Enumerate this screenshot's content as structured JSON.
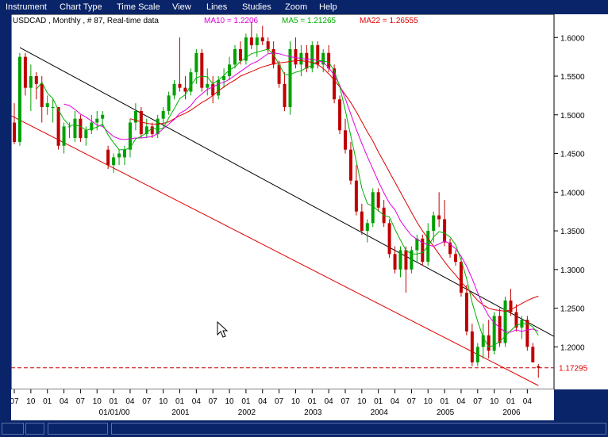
{
  "menu": {
    "items": [
      {
        "label": "Instrument"
      },
      {
        "label": "Chart Type"
      },
      {
        "label": "Time Scale"
      },
      {
        "label": "View"
      },
      {
        "label": "Lines"
      },
      {
        "label": "Studies"
      },
      {
        "label": "Zoom"
      },
      {
        "label": "Help"
      }
    ]
  },
  "legend": {
    "instrument": "USDCAD , Monthly , # 87, Real-time data",
    "ma10": "MA10 = 1.2206",
    "ma5": "MA5 = 1.21265",
    "ma22": "MA22 = 1.26555"
  },
  "colors": {
    "background": "#ffffff",
    "menubar": "#0a246a",
    "up_candle": "#00a000",
    "down_candle": "#c00000",
    "ma10": "#e000e0",
    "ma5": "#00b000",
    "ma22": "#e00000",
    "upper_channel": "#000000",
    "lower_channel": "#e00000"
  },
  "current_price_label": "1.17295",
  "chart_data": {
    "type": "candlestick",
    "instrument": "USDCAD",
    "timeframe": "Monthly",
    "ylim": [
      1.145,
      1.63
    ],
    "y_ticks": [
      "1.6000",
      "1.5500",
      "1.5000",
      "1.4500",
      "1.4000",
      "1.3500",
      "1.3000",
      "1.2500",
      "1.2000"
    ],
    "x_ticks": [
      "07",
      "10",
      "01",
      "04",
      "07",
      "10",
      "01",
      "04",
      "07",
      "10",
      "01",
      "04",
      "07",
      "10",
      "01",
      "04",
      "07",
      "10",
      "01",
      "04",
      "07",
      "10",
      "01",
      "04",
      "07",
      "10",
      "01",
      "04",
      "07",
      "10",
      "01",
      "04"
    ],
    "x_year_labels": [
      {
        "label": "01/01/00",
        "at": 6
      },
      {
        "label": "2001",
        "at": 10
      },
      {
        "label": "2002",
        "at": 14
      },
      {
        "label": "2003",
        "at": 18
      },
      {
        "label": "2004",
        "at": 22
      },
      {
        "label": "2005",
        "at": 26
      },
      {
        "label": "2006",
        "at": 30
      }
    ],
    "first_month": "1999-07",
    "candles": [
      [
        1.49,
        1.515,
        1.462,
        1.465
      ],
      [
        1.465,
        1.58,
        1.46,
        1.575
      ],
      [
        1.575,
        1.58,
        1.525,
        1.535
      ],
      [
        1.535,
        1.565,
        1.505,
        1.55
      ],
      [
        1.55,
        1.555,
        1.52,
        1.54
      ],
      [
        1.54,
        1.55,
        1.49,
        1.51
      ],
      [
        1.51,
        1.525,
        1.5,
        1.515
      ],
      [
        1.51,
        1.52,
        1.49,
        1.51
      ],
      [
        1.51,
        1.51,
        1.455,
        1.46
      ],
      [
        1.46,
        1.49,
        1.45,
        1.485
      ],
      [
        1.485,
        1.49,
        1.47,
        1.485
      ],
      [
        1.47,
        1.505,
        1.465,
        1.495
      ],
      [
        1.495,
        1.5,
        1.465,
        1.47
      ],
      [
        1.47,
        1.485,
        1.46,
        1.48
      ],
      [
        1.48,
        1.5,
        1.475,
        1.49
      ],
      [
        1.49,
        1.505,
        1.48,
        1.495
      ],
      [
        1.495,
        1.505,
        1.485,
        1.5
      ],
      [
        1.455,
        1.46,
        1.43,
        1.435
      ],
      [
        1.435,
        1.45,
        1.425,
        1.445
      ],
      [
        1.445,
        1.455,
        1.435,
        1.45
      ],
      [
        1.445,
        1.46,
        1.435,
        1.455
      ],
      [
        1.455,
        1.495,
        1.445,
        1.49
      ],
      [
        1.49,
        1.515,
        1.48,
        1.505
      ],
      [
        1.505,
        1.51,
        1.47,
        1.475
      ],
      [
        1.475,
        1.495,
        1.47,
        1.485
      ],
      [
        1.485,
        1.49,
        1.47,
        1.475
      ],
      [
        1.475,
        1.5,
        1.47,
        1.495
      ],
      [
        1.495,
        1.51,
        1.485,
        1.505
      ],
      [
        1.505,
        1.53,
        1.5,
        1.525
      ],
      [
        1.525,
        1.545,
        1.52,
        1.54
      ],
      [
        1.54,
        1.6,
        1.53,
        1.535
      ],
      [
        1.535,
        1.55,
        1.52,
        1.53
      ],
      [
        1.53,
        1.56,
        1.525,
        1.555
      ],
      [
        1.555,
        1.585,
        1.54,
        1.58
      ],
      [
        1.58,
        1.585,
        1.53,
        1.535
      ],
      [
        1.535,
        1.56,
        1.525,
        1.54
      ],
      [
        1.54,
        1.55,
        1.515,
        1.525
      ],
      [
        1.525,
        1.55,
        1.52,
        1.545
      ],
      [
        1.545,
        1.56,
        1.535,
        1.55
      ],
      [
        1.55,
        1.575,
        1.545,
        1.565
      ],
      [
        1.565,
        1.59,
        1.56,
        1.585
      ],
      [
        1.585,
        1.595,
        1.565,
        1.57
      ],
      [
        1.57,
        1.605,
        1.565,
        1.6
      ],
      [
        1.6,
        1.62,
        1.585,
        1.59
      ],
      [
        1.59,
        1.605,
        1.575,
        1.6
      ],
      [
        1.6,
        1.615,
        1.59,
        1.595
      ],
      [
        1.595,
        1.6,
        1.58,
        1.585
      ],
      [
        1.585,
        1.595,
        1.56,
        1.565
      ],
      [
        1.565,
        1.57,
        1.535,
        1.54
      ],
      [
        1.54,
        1.555,
        1.505,
        1.51
      ],
      [
        1.51,
        1.595,
        1.5,
        1.585
      ],
      [
        1.585,
        1.6,
        1.56,
        1.565
      ],
      [
        1.565,
        1.59,
        1.55,
        1.58
      ],
      [
        1.58,
        1.59,
        1.555,
        1.56
      ],
      [
        1.56,
        1.595,
        1.555,
        1.59
      ],
      [
        1.59,
        1.595,
        1.56,
        1.565
      ],
      [
        1.565,
        1.585,
        1.555,
        1.58
      ],
      [
        1.58,
        1.59,
        1.555,
        1.56
      ],
      [
        1.56,
        1.565,
        1.515,
        1.52
      ],
      [
        1.52,
        1.525,
        1.475,
        1.48
      ],
      [
        1.48,
        1.495,
        1.45,
        1.455
      ],
      [
        1.455,
        1.465,
        1.41,
        1.415
      ],
      [
        1.415,
        1.435,
        1.37,
        1.375
      ],
      [
        1.375,
        1.385,
        1.345,
        1.35
      ],
      [
        1.35,
        1.365,
        1.335,
        1.36
      ],
      [
        1.36,
        1.405,
        1.355,
        1.4
      ],
      [
        1.4,
        1.405,
        1.375,
        1.38
      ],
      [
        1.38,
        1.39,
        1.355,
        1.36
      ],
      [
        1.36,
        1.365,
        1.315,
        1.32
      ],
      [
        1.32,
        1.33,
        1.295,
        1.3
      ],
      [
        1.3,
        1.33,
        1.29,
        1.325
      ],
      [
        1.325,
        1.33,
        1.27,
        1.3
      ],
      [
        1.3,
        1.33,
        1.295,
        1.325
      ],
      [
        1.325,
        1.345,
        1.31,
        1.34
      ],
      [
        1.34,
        1.345,
        1.305,
        1.31
      ],
      [
        1.31,
        1.36,
        1.305,
        1.35
      ],
      [
        1.35,
        1.375,
        1.335,
        1.37
      ],
      [
        1.37,
        1.4,
        1.355,
        1.365
      ],
      [
        1.365,
        1.39,
        1.33,
        1.335
      ],
      [
        1.335,
        1.34,
        1.315,
        1.32
      ],
      [
        1.32,
        1.325,
        1.305,
        1.31
      ],
      [
        1.31,
        1.315,
        1.265,
        1.27
      ],
      [
        1.27,
        1.28,
        1.215,
        1.22
      ],
      [
        1.22,
        1.23,
        1.175,
        1.18
      ],
      [
        1.18,
        1.205,
        1.175,
        1.2
      ],
      [
        1.2,
        1.23,
        1.185,
        1.215
      ],
      [
        1.215,
        1.235,
        1.185,
        1.195
      ],
      [
        1.195,
        1.245,
        1.19,
        1.24
      ],
      [
        1.24,
        1.25,
        1.2,
        1.205
      ],
      [
        1.205,
        1.265,
        1.2,
        1.26
      ],
      [
        1.26,
        1.275,
        1.24,
        1.245
      ],
      [
        1.245,
        1.255,
        1.22,
        1.225
      ],
      [
        1.225,
        1.24,
        1.21,
        1.235
      ],
      [
        1.235,
        1.24,
        1.195,
        1.2
      ],
      [
        1.2,
        1.205,
        1.195,
        1.18
      ],
      [
        1.175,
        1.178,
        1.16,
        1.173
      ]
    ],
    "ma5_values": [
      null,
      null,
      null,
      null,
      1.533,
      1.542,
      1.528,
      1.521,
      1.506,
      1.494,
      1.486,
      1.487,
      1.485,
      1.48,
      1.482,
      1.484,
      1.488,
      1.474,
      1.464,
      1.455,
      1.455,
      1.457,
      1.469,
      1.472,
      1.477,
      1.483,
      1.481,
      1.483,
      1.496,
      1.508,
      1.521,
      1.526,
      1.538,
      1.548,
      1.55,
      1.549,
      1.54,
      1.545,
      1.551,
      1.558,
      1.562,
      1.569,
      1.574,
      1.579,
      1.581,
      1.583,
      1.585,
      1.578,
      1.565,
      1.552,
      1.552,
      1.555,
      1.557,
      1.561,
      1.564,
      1.57,
      1.57,
      1.568,
      1.557,
      1.536,
      1.506,
      1.473,
      1.44,
      1.405,
      1.385,
      1.382,
      1.376,
      1.37,
      1.368,
      1.352,
      1.338,
      1.325,
      1.32,
      1.32,
      1.322,
      1.33,
      1.342,
      1.349,
      1.347,
      1.342,
      1.332,
      1.312,
      1.288,
      1.257,
      1.233,
      1.212,
      1.2,
      1.202,
      1.207,
      1.214,
      1.221,
      1.228,
      1.23,
      1.23,
      1.226,
      1.215
    ],
    "ma10_values": [
      null,
      null,
      null,
      null,
      null,
      null,
      null,
      null,
      null,
      1.514,
      1.512,
      1.507,
      1.501,
      1.497,
      1.492,
      1.487,
      1.485,
      1.478,
      1.472,
      1.469,
      1.468,
      1.469,
      1.47,
      1.47,
      1.471,
      1.472,
      1.476,
      1.482,
      1.488,
      1.494,
      1.502,
      1.506,
      1.512,
      1.521,
      1.527,
      1.533,
      1.536,
      1.54,
      1.542,
      1.546,
      1.551,
      1.556,
      1.561,
      1.566,
      1.569,
      1.574,
      1.579,
      1.58,
      1.579,
      1.577,
      1.575,
      1.574,
      1.573,
      1.572,
      1.572,
      1.57,
      1.568,
      1.561,
      1.551,
      1.538,
      1.521,
      1.501,
      1.481,
      1.463,
      1.446,
      1.43,
      1.414,
      1.399,
      1.386,
      1.377,
      1.363,
      1.353,
      1.344,
      1.339,
      1.335,
      1.332,
      1.33,
      1.333,
      1.337,
      1.333,
      1.327,
      1.317,
      1.304,
      1.288,
      1.27,
      1.253,
      1.24,
      1.231,
      1.225,
      1.219,
      1.219,
      1.222,
      1.22,
      1.222,
      1.223,
      1.2206
    ],
    "ma22_values": [
      null,
      null,
      null,
      null,
      null,
      null,
      null,
      null,
      null,
      null,
      null,
      null,
      null,
      null,
      null,
      null,
      null,
      null,
      null,
      null,
      null,
      1.495,
      1.493,
      1.491,
      1.489,
      1.488,
      1.488,
      1.489,
      1.491,
      1.495,
      1.499,
      1.502,
      1.506,
      1.511,
      1.516,
      1.52,
      1.525,
      1.531,
      1.536,
      1.541,
      1.545,
      1.55,
      1.553,
      1.556,
      1.559,
      1.562,
      1.564,
      1.566,
      1.567,
      1.568,
      1.569,
      1.57,
      1.57,
      1.569,
      1.568,
      1.565,
      1.56,
      1.553,
      1.545,
      1.536,
      1.526,
      1.516,
      1.504,
      1.491,
      1.478,
      1.466,
      1.452,
      1.439,
      1.426,
      1.413,
      1.4,
      1.387,
      1.374,
      1.361,
      1.35,
      1.34,
      1.33,
      1.32,
      1.31,
      1.301,
      1.293,
      1.284,
      1.276,
      1.268,
      1.26,
      1.254,
      1.25,
      1.248,
      1.247,
      1.246,
      1.248,
      1.252,
      1.256,
      1.26,
      1.263,
      1.26555
    ]
  }
}
